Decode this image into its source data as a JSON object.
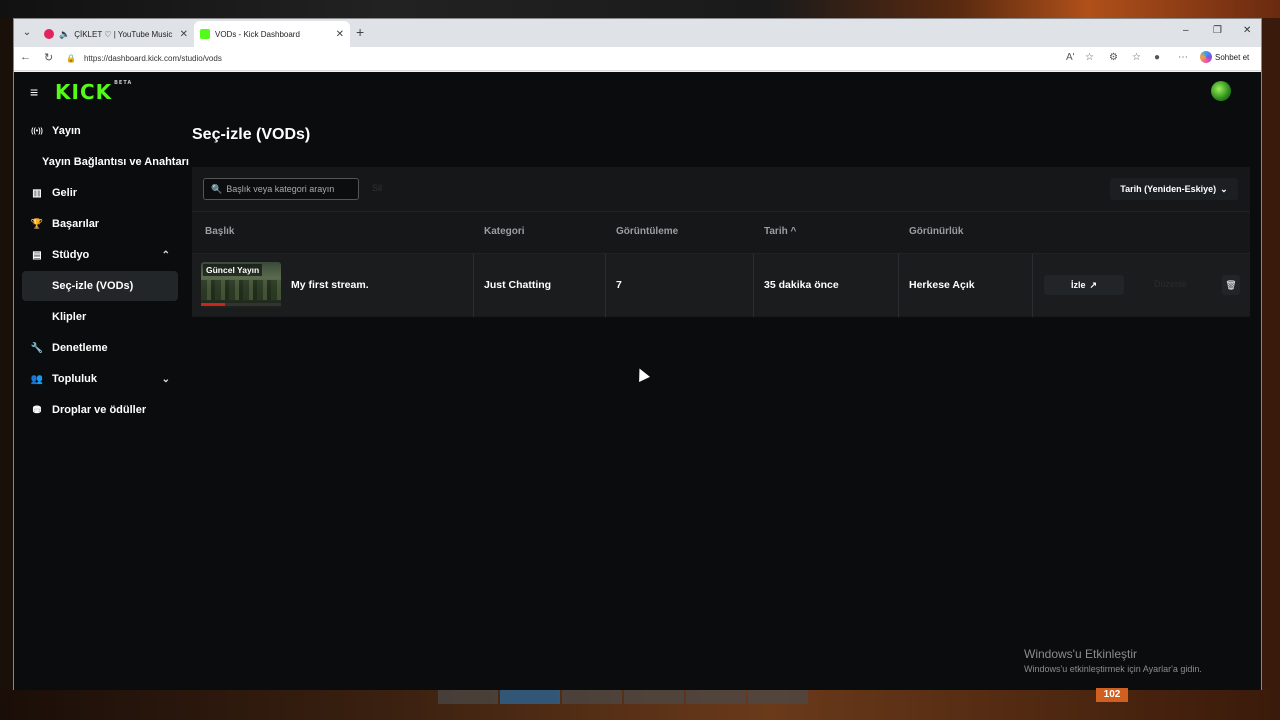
{
  "browser": {
    "tabs": [
      {
        "title": "ÇİKLET ♡ | YouTube Music",
        "favicon_color": "#e0245e"
      },
      {
        "title": "VODs - Kick Dashboard",
        "favicon_color": "#53fc18"
      }
    ],
    "url": "https://dashboard.kick.com/studio/vods",
    "copilot_label": "Sohbet et",
    "icons": {
      "tab_dropdown": "chevron-down-icon",
      "speaker": "speaker-icon",
      "new_tab": "plus-icon",
      "minimize": "minimize-icon",
      "maximize": "maximize-icon",
      "close": "close-icon",
      "back": "back-arrow-icon",
      "refresh": "refresh-icon",
      "lock": "lock-icon"
    },
    "glyphs": {
      "dropdown": "⌄",
      "speaker": "🔈",
      "close": "✕",
      "new_tab": "+",
      "minimize": "–",
      "maximize": "❐",
      "back": "←",
      "refresh": "↻",
      "lock": "🔒",
      "read_aloud": "A'",
      "favorite": "☆",
      "extensions": "⚙",
      "favorites_bar": "☆",
      "profile": "●",
      "more": "⋯"
    }
  },
  "app": {
    "logo": "KICK",
    "logo_badge": "BETA",
    "brand_color": "#53fc18",
    "menu_glyph": "≡"
  },
  "sidebar": {
    "items": [
      {
        "label": "Yayın",
        "icon": "broadcast-icon",
        "glyph": "((•))"
      },
      {
        "label": "Yayın Bağlantısı ve Anahtarı",
        "icon": "",
        "glyph": ""
      },
      {
        "label": "Gelir",
        "icon": "chart-icon",
        "glyph": "▥"
      },
      {
        "label": "Başarılar",
        "icon": "trophy-icon",
        "glyph": "🏆"
      },
      {
        "label": "Stüdyo",
        "icon": "studio-icon",
        "glyph": "▤",
        "chevron": "⌃"
      },
      {
        "label": "Seç-izle (VODs)",
        "icon": "",
        "glyph": ""
      },
      {
        "label": "Klipler",
        "icon": "",
        "glyph": ""
      },
      {
        "label": "Denetleme",
        "icon": "wrench-icon",
        "glyph": "🔧"
      },
      {
        "label": "Topluluk",
        "icon": "community-icon",
        "glyph": "👥",
        "chevron": "⌄"
      },
      {
        "label": "Droplar ve ödüller",
        "icon": "drops-icon",
        "glyph": "⛃"
      }
    ]
  },
  "page": {
    "title": "Seç-izle (VODs)",
    "search_placeholder": "Başlık veya kategori arayın",
    "search_glyph": "🔍",
    "ghost_button": "Sil",
    "sort_label": "Tarih (Yeniden-Eskiye)",
    "sort_chevron": "⌄"
  },
  "table": {
    "headers": [
      "Başlık",
      "Kategori",
      "Görüntüleme",
      "Tarih",
      "Görünürlük"
    ],
    "sort_indicator": "^",
    "rows": [
      {
        "thumb_label": "Güncel Yayın",
        "title": "My first stream.",
        "category": "Just Chatting",
        "views": "7",
        "date": "35 dakika önce",
        "visibility": "Herkese Açık",
        "watch_label": "İzle",
        "watch_glyph": "↗",
        "ghost_action": "Düzenle",
        "delete_glyph": "🗑"
      }
    ]
  },
  "overlay": {
    "activation_title": "Windows'u Etkinleştir",
    "activation_sub": "Windows'u etkinleştirmek için Ayarlar'a gidin."
  },
  "taskbar": {
    "badge": "102"
  }
}
